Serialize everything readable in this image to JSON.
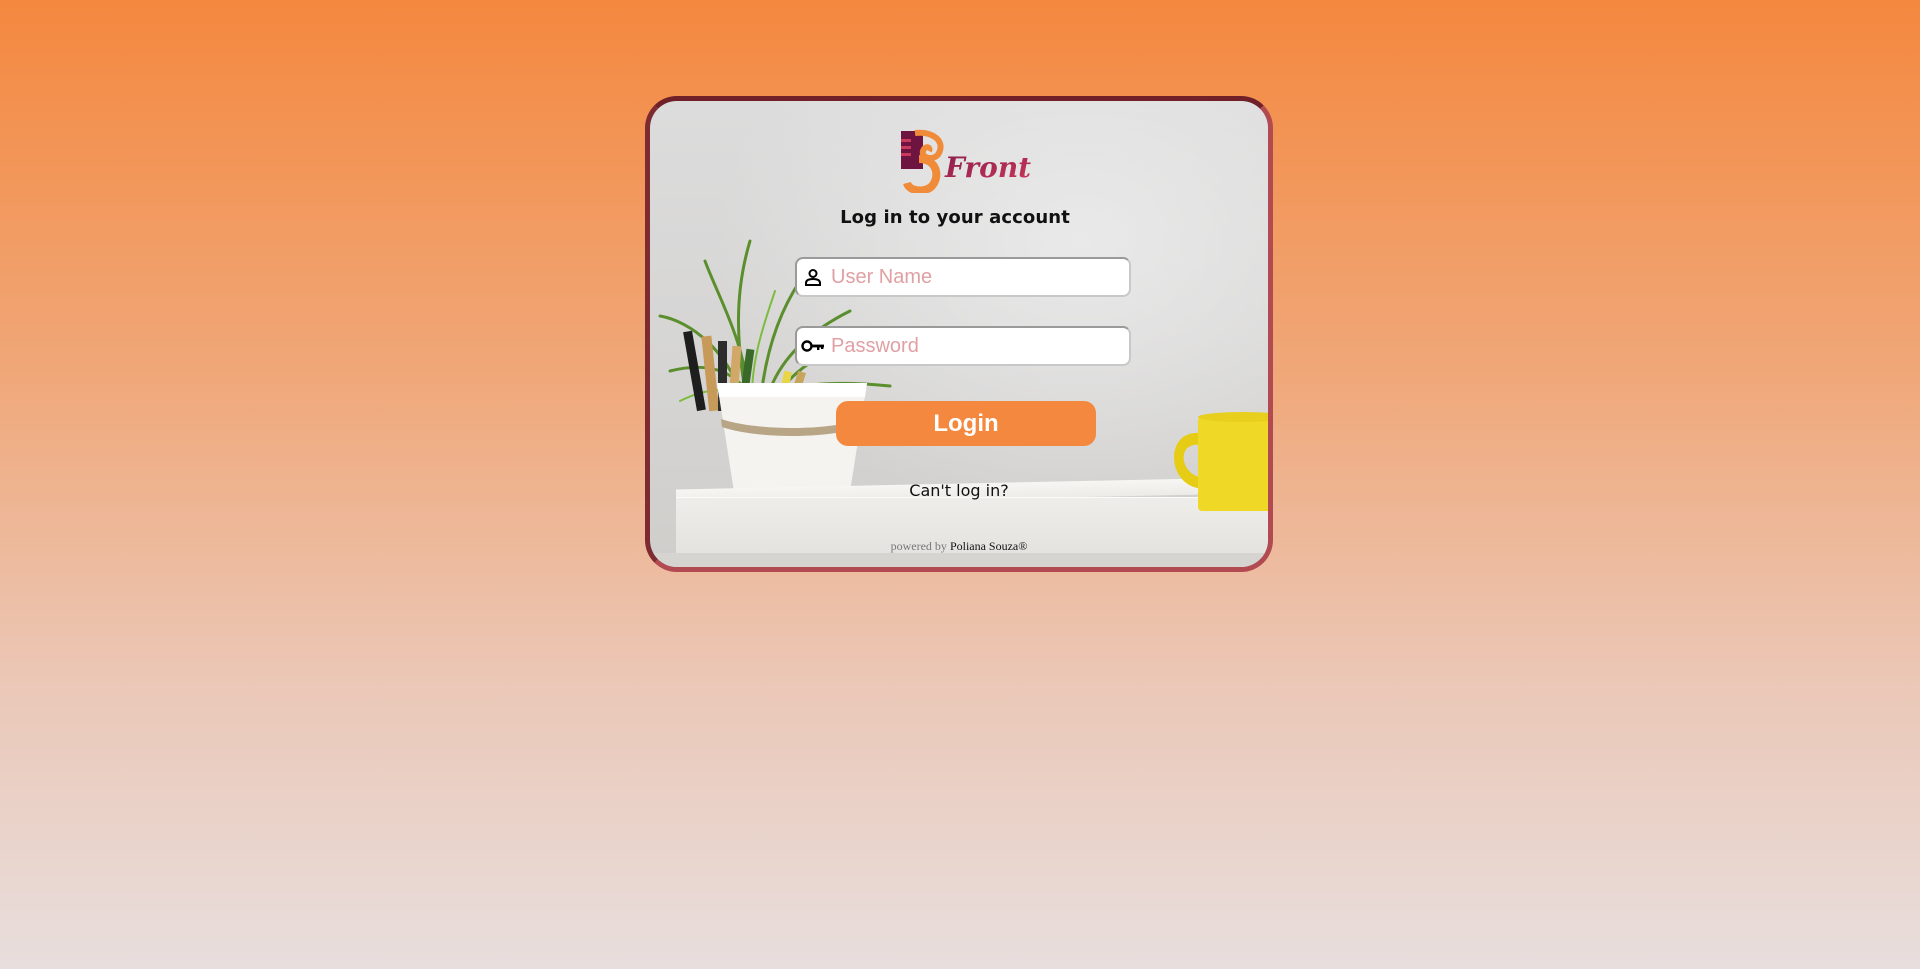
{
  "app": {
    "title": "Log in to your account",
    "logo_icon": "ps-front-logo"
  },
  "form": {
    "username_placeholder": "User Name",
    "username_value": "",
    "username_icon": "person-icon",
    "password_placeholder": "Password",
    "password_value": "",
    "password_icon": "key-icon",
    "login_label": "Login",
    "cant_login_label": "Can't log in?"
  },
  "footer": {
    "powered_prefix": "powered by",
    "author": "Poliana Souza®"
  },
  "colors": {
    "accent": "#f4883f",
    "card_border": "#b24a52",
    "placeholder": "#e0a0a3"
  }
}
